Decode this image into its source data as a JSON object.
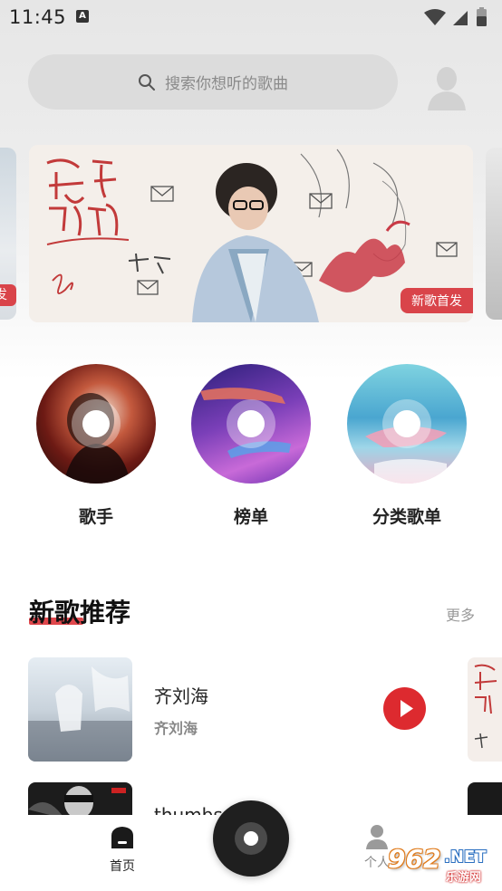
{
  "status_bar": {
    "time": "11:45",
    "notification_icon": "A"
  },
  "search": {
    "placeholder": "搜索你想听的歌曲",
    "icon": "search-icon"
  },
  "banner": {
    "tag": "新歌首发",
    "title_art": "告白时刻",
    "artist_art": "王子奇",
    "left_peek_tag": "发"
  },
  "categories": [
    {
      "label": "歌手",
      "icon": "singer-disc"
    },
    {
      "label": "榜单",
      "icon": "chart-disc"
    },
    {
      "label": "分类歌单",
      "icon": "playlist-disc"
    }
  ],
  "new_songs": {
    "title": "新歌推荐",
    "more_label": "更多",
    "items": [
      {
        "title": "齐刘海",
        "artist": "齐刘海"
      },
      {
        "title": "thumbs",
        "artist": ""
      }
    ]
  },
  "bottom_nav": {
    "home_label": "首页",
    "me_label": "个人"
  },
  "watermark": {
    "brand": "962",
    "tld": ".NET",
    "sub": "乐游网"
  },
  "colors": {
    "accent": "#e0474c",
    "play_button": "#dd2a2f",
    "search_bg": "#dcdcdc"
  }
}
